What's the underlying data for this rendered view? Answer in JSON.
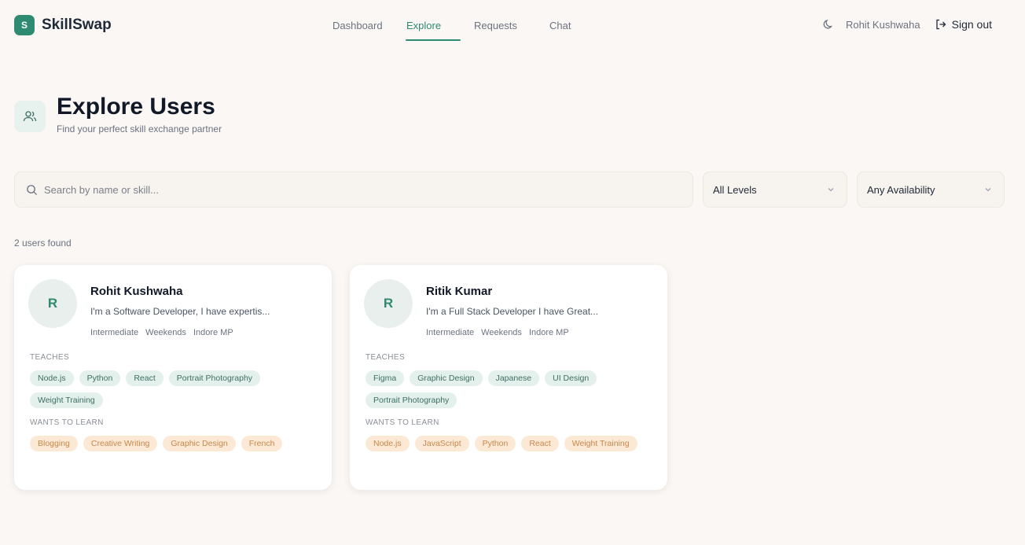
{
  "brand": {
    "logo_letter": "S",
    "name": "SkillSwap"
  },
  "nav": {
    "items": [
      {
        "label": "Dashboard",
        "active": false
      },
      {
        "label": "Explore",
        "active": true
      },
      {
        "label": "Requests",
        "active": false
      },
      {
        "label": "Chat",
        "active": false
      }
    ]
  },
  "header": {
    "user_name": "Rohit Kushwaha",
    "signout_label": "Sign out",
    "theme_icon": "moon-icon"
  },
  "page": {
    "title": "Explore Users",
    "subtitle": "Find your perfect skill exchange partner",
    "icon": "users-icon"
  },
  "filters": {
    "search_placeholder": "Search by name or skill...",
    "level_value": "All Levels",
    "availability_value": "Any Availability"
  },
  "results": {
    "count_text": "2 users found"
  },
  "colors": {
    "accent": "#2f8a72",
    "background": "#faf7f4",
    "teach_tag": "#e3f0ec",
    "learn_tag": "#fbe9d5"
  },
  "users": [
    {
      "initial": "R",
      "name": "Rohit Kushwaha",
      "bio": "I'm a Software Developer, I have expertis...",
      "level": "Intermediate",
      "availability": "Weekends",
      "location": "Indore MP",
      "teaches_label": "TEACHES",
      "teaches": [
        "Node.js",
        "Python",
        "React",
        "Portrait Photography",
        "Weight Training"
      ],
      "learn_label": "WANTS TO LEARN",
      "learns": [
        "Blogging",
        "Creative Writing",
        "Graphic Design",
        "French"
      ]
    },
    {
      "initial": "R",
      "name": "Ritik Kumar",
      "bio": "I'm a Full Stack Developer I have Great...",
      "level": "Intermediate",
      "availability": "Weekends",
      "location": "Indore MP",
      "teaches_label": "TEACHES",
      "teaches": [
        "Figma",
        "Graphic Design",
        "Japanese",
        "UI Design",
        "Portrait Photography"
      ],
      "learn_label": "WANTS TO LEARN",
      "learns": [
        "Node.js",
        "JavaScript",
        "Python",
        "React",
        "Weight Training"
      ]
    }
  ]
}
